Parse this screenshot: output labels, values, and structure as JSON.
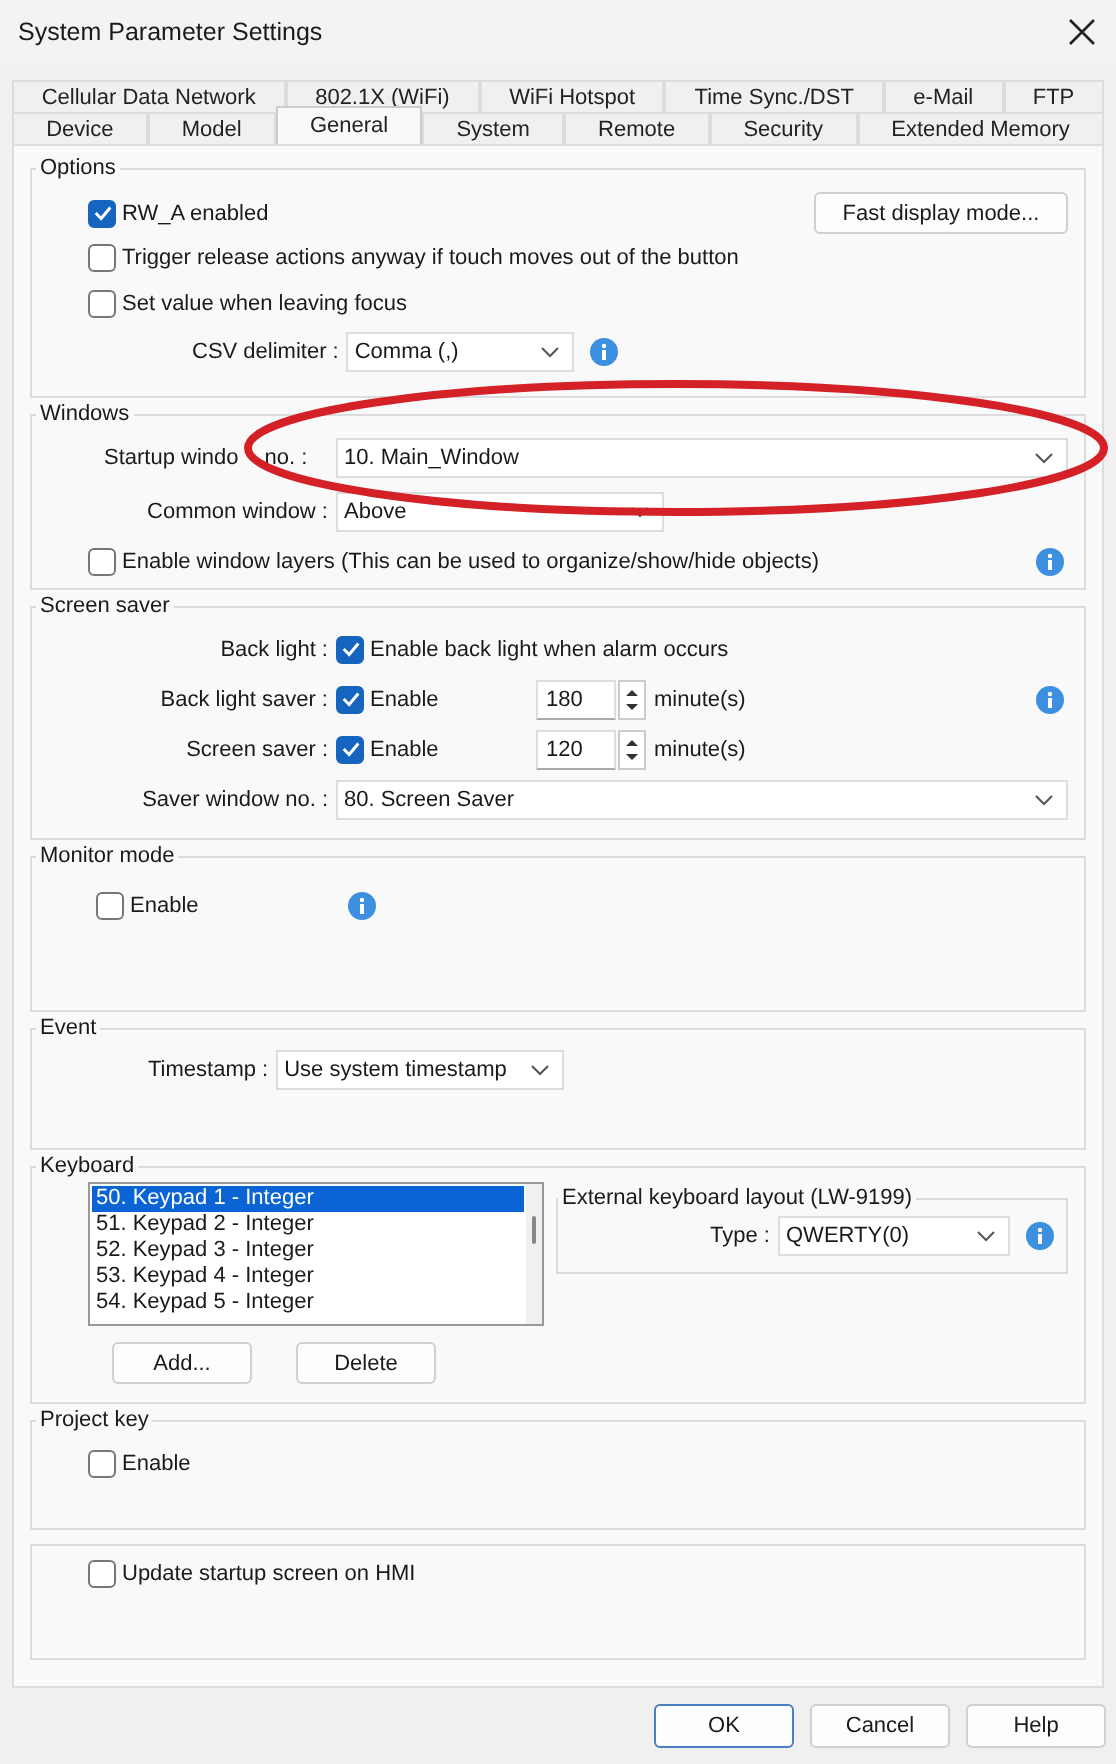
{
  "window": {
    "title": "System Parameter Settings"
  },
  "tab_rows": [
    [
      {
        "label": "Cellular Data Network",
        "selected": false
      },
      {
        "label": "802.1X (WiFi)",
        "selected": false
      },
      {
        "label": "WiFi Hotspot",
        "selected": false
      },
      {
        "label": "Time Sync./DST",
        "selected": false
      },
      {
        "label": "e-Mail",
        "selected": false
      },
      {
        "label": "FTP",
        "selected": false
      }
    ],
    [
      {
        "label": "Device",
        "selected": false
      },
      {
        "label": "Model",
        "selected": false
      },
      {
        "label": "General",
        "selected": true
      },
      {
        "label": "System",
        "selected": false
      },
      {
        "label": "Remote",
        "selected": false
      },
      {
        "label": "Security",
        "selected": false
      },
      {
        "label": "Extended Memory",
        "selected": false
      }
    ]
  ],
  "options": {
    "title": "Options",
    "checkboxes": [
      {
        "label": "RW_A enabled",
        "checked": true
      },
      {
        "label": "Trigger release actions anyway if touch moves out of the button",
        "checked": false
      },
      {
        "label": "Set value when leaving focus",
        "checked": false
      }
    ],
    "fast_button": "Fast display mode...",
    "csv_label": "CSV delimiter :",
    "csv_value": "Comma (,)"
  },
  "windows": {
    "title": "Windows",
    "startup_label_parts": [
      "Startup windo",
      "no. :"
    ],
    "startup_value": "10. Main_Window",
    "common_label": "Common window :",
    "common_value": "Above",
    "layers": {
      "label": "Enable window layers (This can be used to organize/show/hide objects)",
      "checked": false
    }
  },
  "screen_saver": {
    "title": "Screen saver",
    "back_light_label": "Back light :",
    "back_light": {
      "label": "Enable back light when alarm occurs",
      "checked": true
    },
    "savers": [
      {
        "label": "Back light saver :",
        "enable": "Enable",
        "checked": true,
        "value": "180",
        "unit": "minute(s)"
      },
      {
        "label": "Screen saver :",
        "enable": "Enable",
        "checked": true,
        "value": "120",
        "unit": "minute(s)"
      }
    ],
    "window_label": "Saver window no. :",
    "window_value": "80. Screen Saver"
  },
  "monitor_mode": {
    "title": "Monitor mode",
    "enable": {
      "label": "Enable",
      "checked": false
    }
  },
  "event": {
    "title": "Event",
    "timestamp_label": "Timestamp :",
    "timestamp_value": "Use system timestamp"
  },
  "keyboard": {
    "title": "Keyboard",
    "items": [
      {
        "label": "50. Keypad 1 - Integer",
        "selected": true
      },
      {
        "label": "51. Keypad 2 - Integer",
        "selected": false
      },
      {
        "label": "52. Keypad 3 - Integer",
        "selected": false
      },
      {
        "label": "53. Keypad 4 - Integer",
        "selected": false
      },
      {
        "label": "54. Keypad 5 - Integer",
        "selected": false
      }
    ],
    "add_button": "Add...",
    "delete_button": "Delete",
    "external_title": "External keyboard layout (LW-9199)",
    "type_label": "Type :",
    "type_value": "QWERTY(0)"
  },
  "project_key": {
    "title": "Project key",
    "enable": {
      "label": "Enable",
      "checked": false
    }
  },
  "update_startup": {
    "label": "Update startup screen on HMI",
    "checked": false
  },
  "buttons": [
    "OK",
    "Cancel",
    "Help"
  ]
}
